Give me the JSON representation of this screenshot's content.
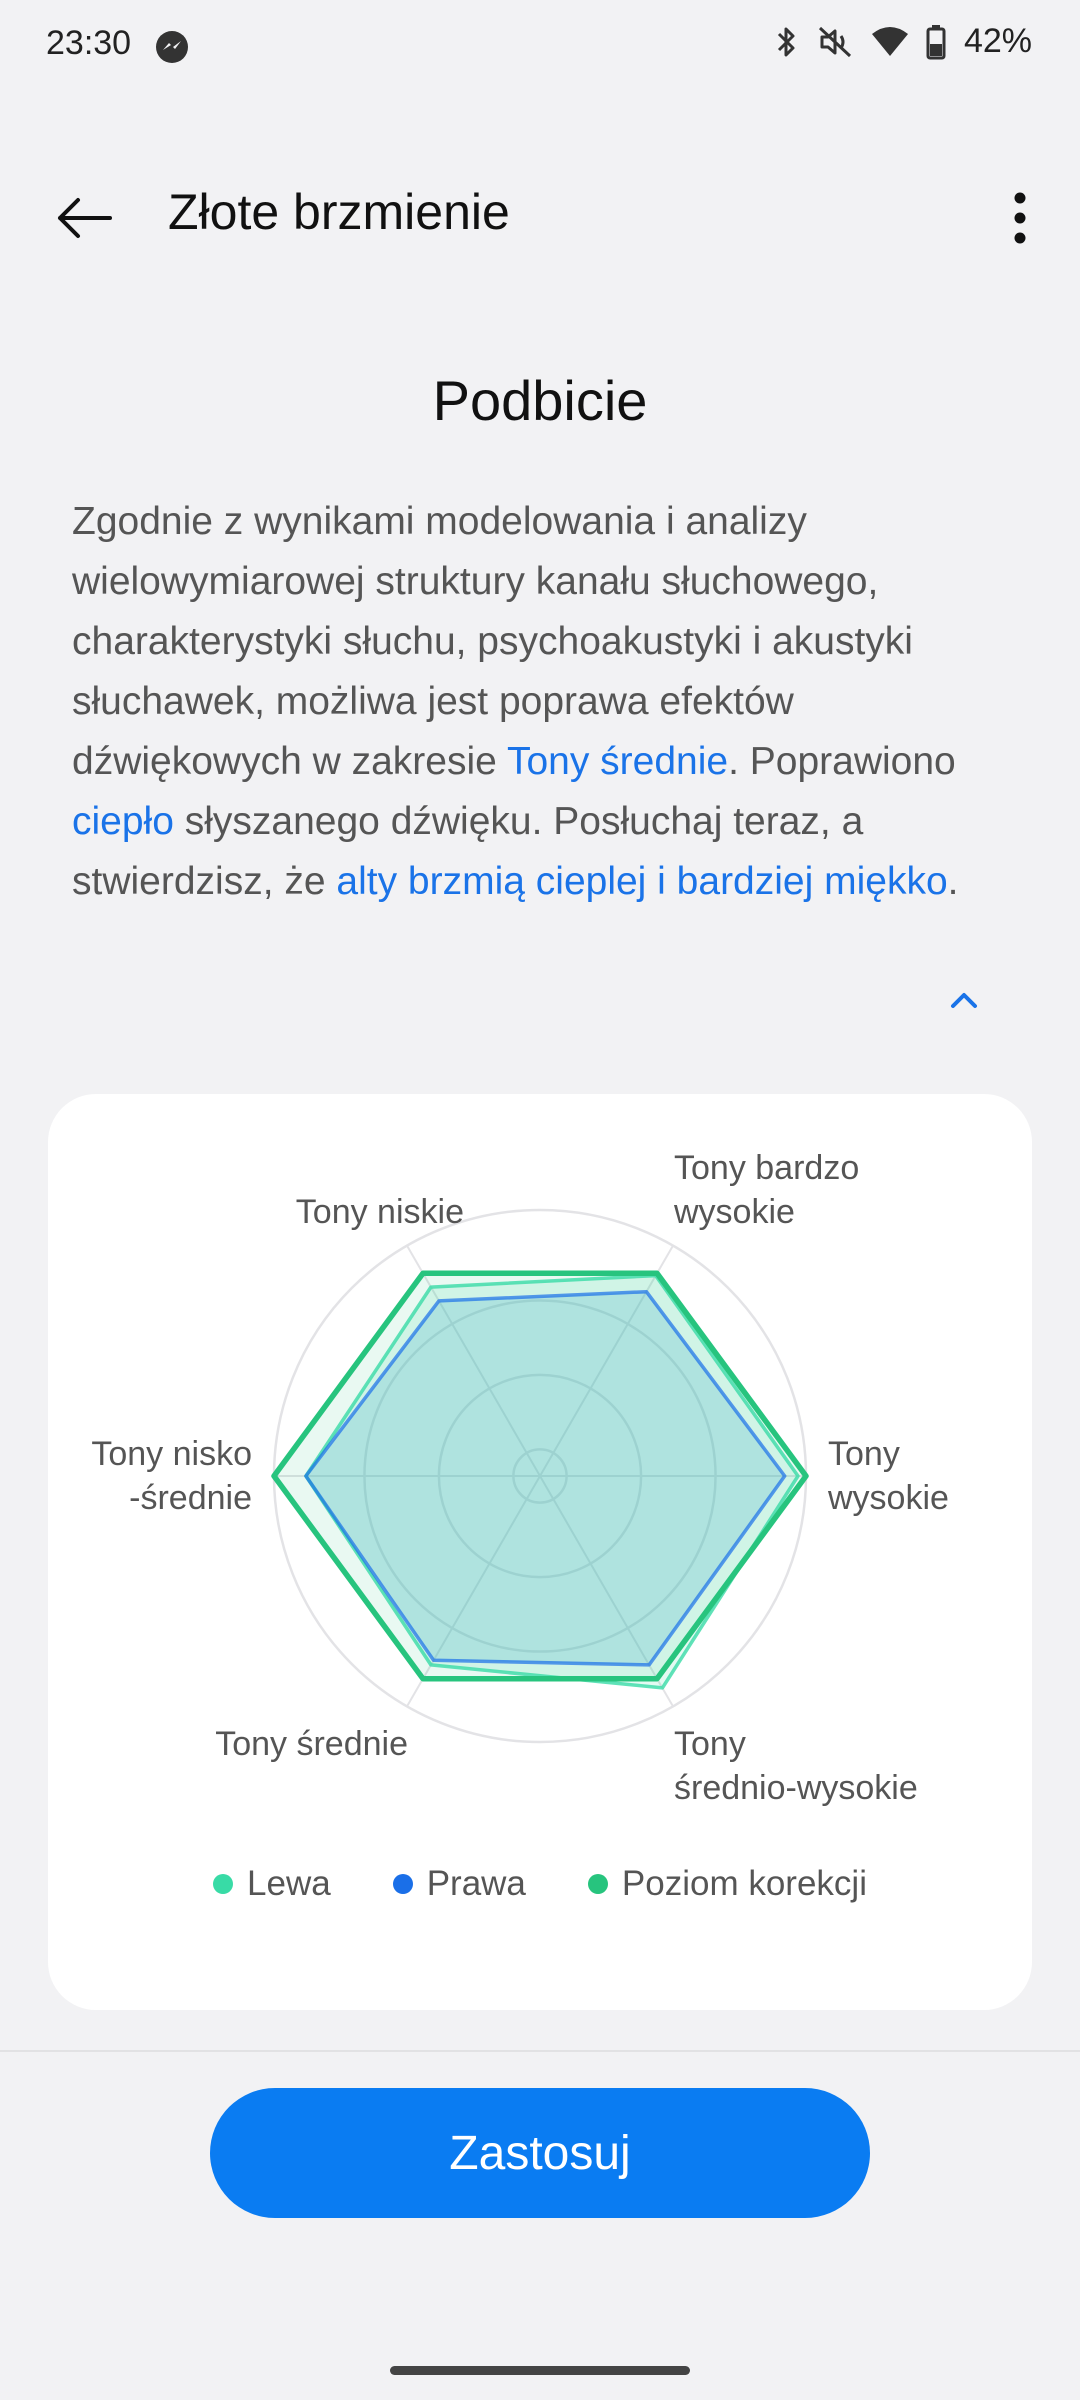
{
  "status_bar": {
    "time": "23:30",
    "battery": "42%",
    "icons": [
      "messenger-icon",
      "bluetooth-icon",
      "mute-icon",
      "wifi-icon",
      "battery-icon"
    ]
  },
  "app_bar": {
    "title": "Złote brzmienie",
    "icons": [
      "back-arrow-icon",
      "more-vert-icon"
    ]
  },
  "section_title": "Podbicie",
  "description": {
    "part1": "Zgodnie z wynikami modelowania i analizy wielowymiarowej struktury kanału słuchowego, charakterystyki słuchu, psychoakustyki i akustyki słuchawek, możliwa jest poprawa efektów dźwiękowych w zakresie ",
    "hl1": "Tony średnie",
    "part2": ". Poprawiono ",
    "hl2": "ciepło",
    "part3": " słyszanego dźwięku. Posłuchaj teraz, a stwierdzisz, że ",
    "hl3": "alty brzmią cieplej i bardziej miękko",
    "part4": ".",
    "highlight_color": "#1a73e8"
  },
  "chart_data": {
    "type": "radar",
    "axes": [
      "Tony niskie",
      "Tony bardzo\nwysokie",
      "Tony\nwysokie",
      "Tony\nśrednio-wysokie",
      "Tony średnie",
      "Tony nisko\n-średnie"
    ],
    "rmax": 1.0,
    "grid_rings": [
      0.1,
      0.38,
      0.66,
      1.0
    ],
    "series": [
      {
        "name": "Lewa",
        "values": [
          0.82,
          0.87,
          0.97,
          0.92,
          0.82,
          0.88
        ],
        "color": "#38dba6"
      },
      {
        "name": "Prawa",
        "values": [
          0.76,
          0.8,
          0.92,
          0.82,
          0.8,
          0.88
        ],
        "color": "#1a6fe8"
      },
      {
        "name": "Poziom korekcji",
        "values": [
          0.88,
          0.88,
          1.0,
          0.88,
          0.88,
          1.0
        ],
        "color": "#27c47e"
      }
    ]
  },
  "legend": [
    {
      "label": "Lewa",
      "color": "#38dba6"
    },
    {
      "label": "Prawa",
      "color": "#1a6fe8"
    },
    {
      "label": "Poziom korekcji",
      "color": "#27c47e"
    }
  ],
  "apply_button": "Zastosuj"
}
